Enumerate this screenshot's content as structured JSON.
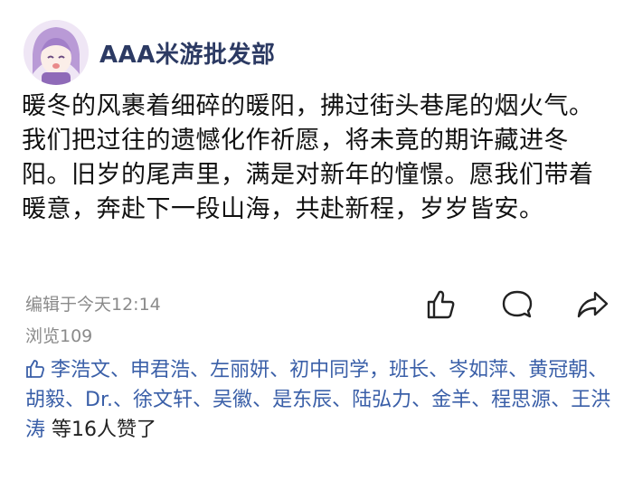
{
  "post": {
    "author": "AAA米游批发部",
    "content": "暖冬的风裹着细碎的暖阳，拂过街头巷尾的烟火气。我们把过往的遗憾化作祈愿，将未竟的期许藏进冬阳。旧岁的尾声里，满是对新年的憧憬。愿我们带着暖意，奔赴下一段山海，共赴新程，岁岁皆安。",
    "edited_time": "编辑于今天12:14",
    "views": "浏览109"
  },
  "actions": {
    "like_icon": "thumbs-up-icon",
    "comment_icon": "comment-bubble-icon",
    "share_icon": "share-arrow-icon"
  },
  "likes": {
    "names": [
      "李浩文",
      "申君浩",
      "左丽妍",
      "初中同学",
      "班长",
      "岑如萍",
      "黄冠朝",
      "胡毅",
      "Dr.",
      "徐文轩",
      "吴徽",
      "是东辰",
      "陆弘力",
      "金羊",
      "程思源",
      "王洪涛"
    ],
    "suffix": "等16人赞了"
  },
  "colors": {
    "author": "#2c3a63",
    "link": "#3a5fa8",
    "meta": "#8a8a8a"
  }
}
